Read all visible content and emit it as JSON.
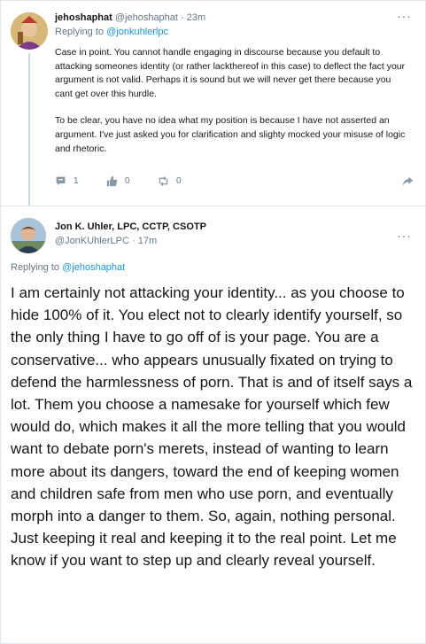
{
  "tweet1": {
    "display_name": "jehoshaphat",
    "handle": "@jehoshaphat",
    "time": "23m",
    "replying_prefix": "Replying to",
    "replying_to": "@jonkuhlerlpc",
    "paragraph1": "Case in point. You cannot handle engaging in discourse because you default to attacking someones identity (or rather lackthereof in this case) to deflect the fact your argument is not valid. Perhaps it is sound but we will never get there because you cant get over this hurdle.",
    "paragraph2": "To be clear, you have no idea what my position is because I have not asserted an argument. I've just asked you for clarification and slighty mocked your misuse of logic and rhetoric.",
    "reply_count": "1",
    "like_count": "0",
    "retweet_count": "0"
  },
  "tweet2": {
    "display_name": "Jon K. Uhler, LPC, CCTP, CSOTP",
    "handle": "@JonKUhlerLPC",
    "time": "17m",
    "replying_prefix": "Replying to",
    "replying_to": "@jehoshaphat",
    "body": "I am certainly not attacking your identity... as you choose to hide 100% of it. You elect not to clearly identify yourself, so the only thing I have to go off of is your page. You are a conservative... who appears unusually fixated on trying to defend the harmlessness of porn. That is and of itself says a lot. Them you choose a namesake for yourself which few would do, which makes it all the more telling that you would want to debate porn's merets, instead of wanting to learn more about its dangers, toward the end of keeping women and children safe from men who use porn, and eventually morph into a danger to them. So, again, nothing personal. Just keeping it real and keeping it to the real point. Let me know if you want to step up and clearly reveal yourself."
  },
  "menu_glyph": "···",
  "separator": "·",
  "colors": {
    "link": "#1b95e0",
    "muted": "#657786",
    "text": "#14171a",
    "border": "#e1e8ed"
  }
}
